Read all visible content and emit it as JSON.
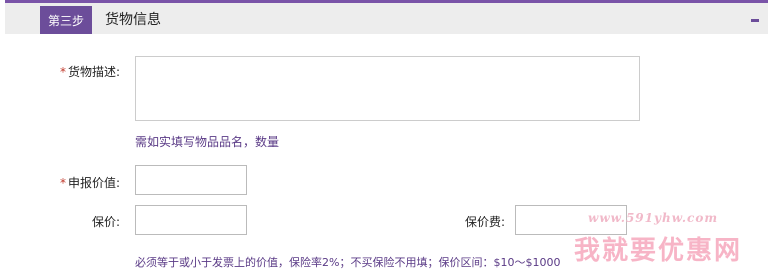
{
  "header": {
    "step_label": "第三步",
    "title": "货物信息",
    "collapse_icon": "minus-icon"
  },
  "form": {
    "required_mark": "*",
    "description": {
      "label": "货物描述:",
      "value": "",
      "hint": "需如实填写物品品名，数量"
    },
    "declared_value": {
      "label": "申报价值:",
      "value": ""
    },
    "insured_value": {
      "label": "保价:",
      "value": ""
    },
    "insurance_fee": {
      "label": "保价费:",
      "value": ""
    },
    "insurance_note": "必须等于或小于发票上的价值，保险率2%；不买保险不用填；保价区间：$10～$1000"
  },
  "watermark": {
    "url": "www.591yhw.com",
    "text": "我就要优惠网"
  },
  "colors": {
    "accent": "#6c4d9a",
    "header_bg": "#ededed",
    "required": "#c0392b",
    "hint_text": "#5a3a86"
  }
}
